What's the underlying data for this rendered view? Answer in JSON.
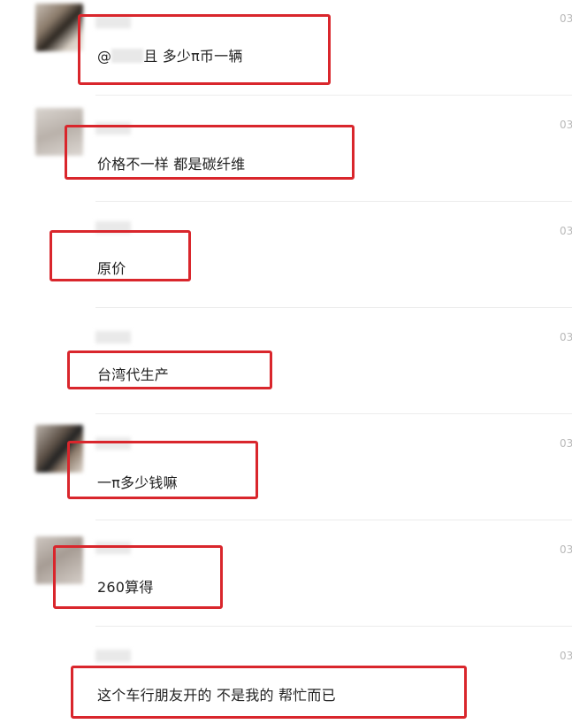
{
  "comments": [
    {
      "message_prefix": "@",
      "message_suffix": "且 多少π币一辆",
      "time": "03"
    },
    {
      "message": "价格不一样  都是碳纤维",
      "time": "03"
    },
    {
      "message": "原价",
      "time": "03"
    },
    {
      "message": "台湾代生产",
      "time": "03"
    },
    {
      "message": "一π多少钱嘛",
      "time": "03"
    },
    {
      "message": "260算得",
      "time": "03"
    },
    {
      "message": "这个车行朋友开的  不是我的  帮忙而已",
      "time": "03"
    }
  ],
  "highlight_color": "#d9262c"
}
